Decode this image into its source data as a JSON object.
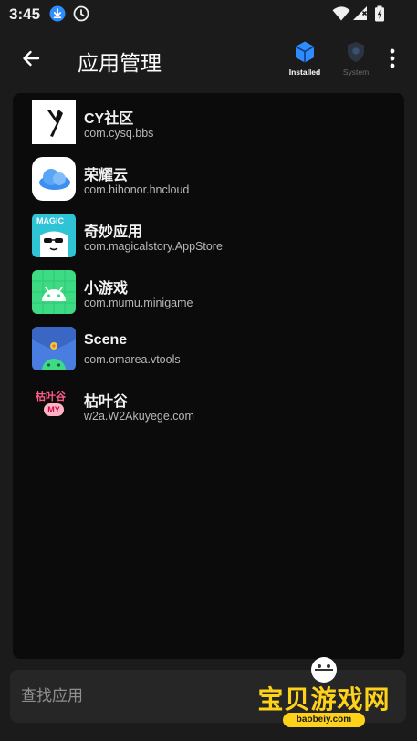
{
  "status_bar": {
    "time": "3:45"
  },
  "header": {
    "title": "应用管理",
    "filters": [
      {
        "label": "Installed",
        "active": true,
        "color": "#2f8cff"
      },
      {
        "label": "System",
        "active": false,
        "color": "#5c5c5c"
      }
    ]
  },
  "apps": [
    {
      "name": "CY社区",
      "package": "com.cysq.bbs",
      "icon": "cy-community-icon"
    },
    {
      "name": "荣耀云",
      "package": "com.hihonor.hncloud",
      "icon": "honor-cloud-icon"
    },
    {
      "name": "奇妙应用",
      "package": "com.magicalstory.AppStore",
      "icon": "magic-app-icon"
    },
    {
      "name": "小游戏",
      "package": "com.mumu.minigame",
      "icon": "android-green-icon"
    },
    {
      "name": "Scene",
      "package": "com.omarea.vtools",
      "icon": "scene-icon"
    },
    {
      "name": "枯叶谷",
      "package": "w2a.W2Akuyege.com",
      "icon": "kuyegu-icon"
    }
  ],
  "search": {
    "placeholder": "查找应用"
  },
  "watermark": {
    "title": "宝贝游戏网",
    "url": "baobeiy.com",
    "logo_text": "枯叶谷",
    "logo_badge": "MY",
    "magic_badge": "MAGIC"
  },
  "colors": {
    "background": "#1b1b1b",
    "panel": "#0b0b0b",
    "accent": "#2f8cff",
    "watermark": "#ffd21a"
  }
}
